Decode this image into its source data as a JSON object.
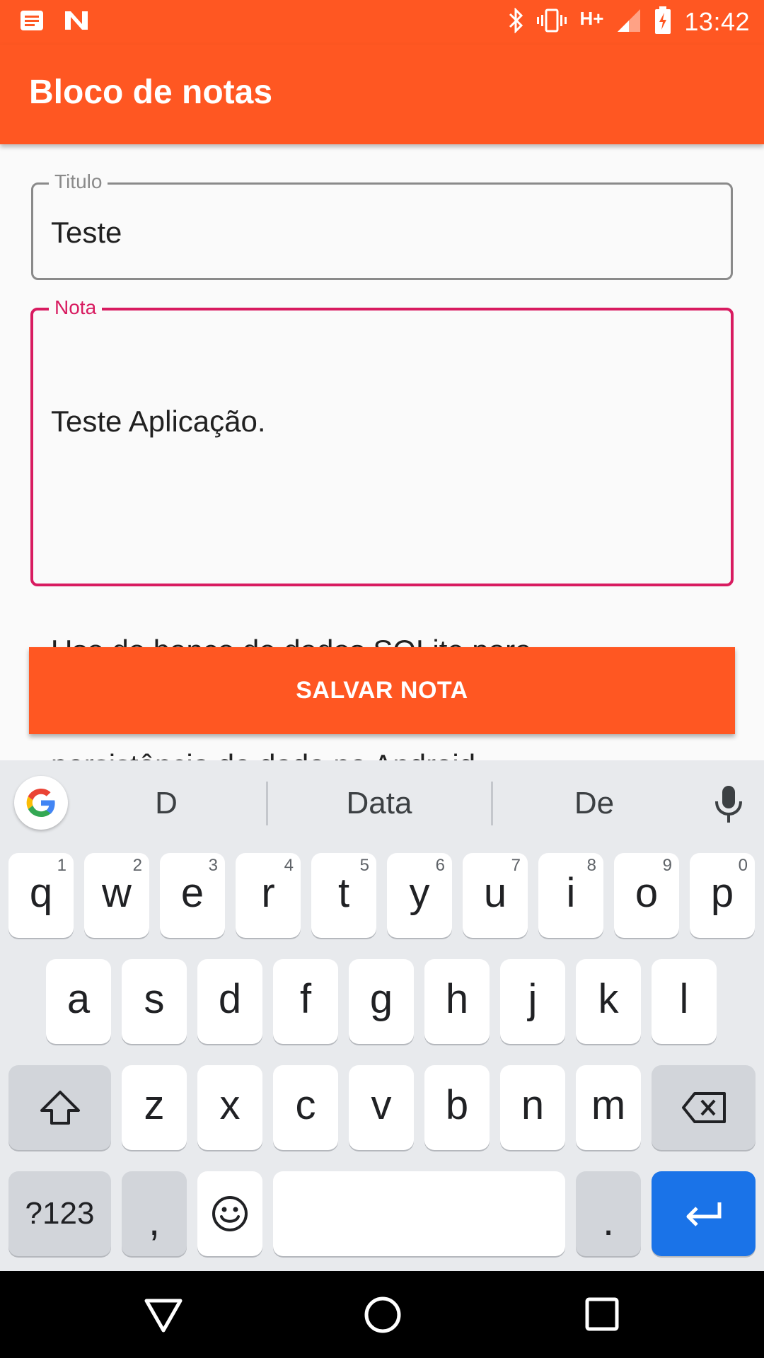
{
  "status_bar": {
    "time": "13:42",
    "network": "H+",
    "icons": [
      "notification-list-icon",
      "n-app-icon",
      "bluetooth-icon",
      "vibrate-icon",
      "signal-icon",
      "battery-charging-icon"
    ]
  },
  "app_bar": {
    "title": "Bloco de notas"
  },
  "form": {
    "title_field": {
      "label": "Titulo",
      "value": "Teste"
    },
    "note_field": {
      "label": "Nota",
      "lines": [
        "Teste Aplicação.",
        "",
        "Uso do banco de dados SQLite para",
        "persistência de dado no Android.",
        "",
        ":"
      ],
      "last_word": "D"
    },
    "save_button": "SALVAR NOTA"
  },
  "keyboard": {
    "suggestions": [
      "D",
      "Data",
      "De"
    ],
    "row1": [
      {
        "k": "q",
        "h": "1"
      },
      {
        "k": "w",
        "h": "2"
      },
      {
        "k": "e",
        "h": "3"
      },
      {
        "k": "r",
        "h": "4"
      },
      {
        "k": "t",
        "h": "5"
      },
      {
        "k": "y",
        "h": "6"
      },
      {
        "k": "u",
        "h": "7"
      },
      {
        "k": "i",
        "h": "8"
      },
      {
        "k": "o",
        "h": "9"
      },
      {
        "k": "p",
        "h": "0"
      }
    ],
    "row2": [
      "a",
      "s",
      "d",
      "f",
      "g",
      "h",
      "j",
      "k",
      "l"
    ],
    "row3": [
      "z",
      "x",
      "c",
      "v",
      "b",
      "n",
      "m"
    ],
    "symbols_key": "?123",
    "comma_key": ",",
    "period_key": "."
  },
  "colors": {
    "accent": "#ff5722",
    "focus": "#d81b60",
    "enter_key": "#1a73e8"
  }
}
